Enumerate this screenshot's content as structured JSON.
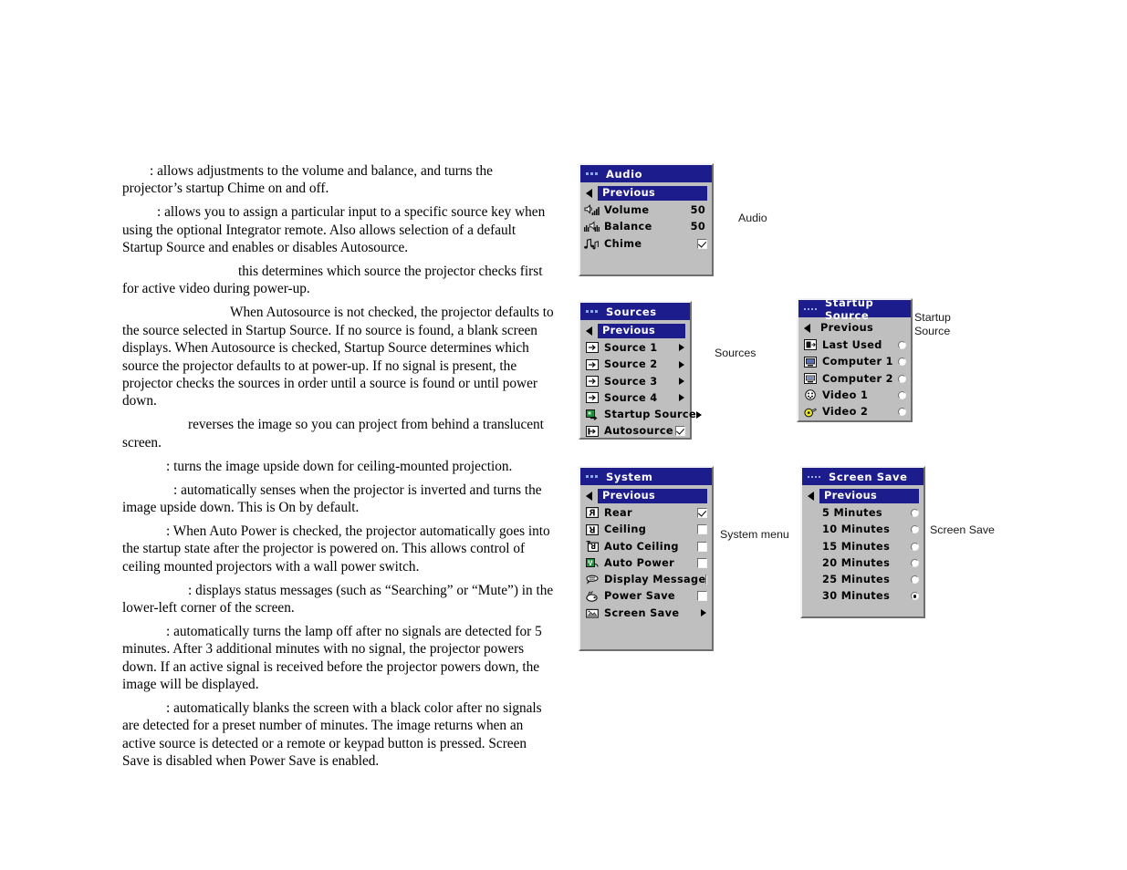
{
  "document": {
    "paragraphs": [
      ": allows adjustments to the volume and balance, and turns the projector’s startup Chime on and off.",
      ": allows you to assign a particular input to a specific source key when using the optional Integrator remote. Also allows selection of a default Startup Source and enables or disables Autosource.",
      "this determines which source the projector checks first for active video during power-up.",
      "When Autosource is not checked, the projector defaults to the source selected in Startup Source. If no source is found, a blank screen displays. When Autosource is checked, Startup Source determines which source the projector defaults to at power-up. If no signal is present, the projector checks the sources in order until a source is found or until power down.",
      "reverses the image so you can project from behind a translucent screen.",
      ": turns the image upside down for ceiling-mounted projection.",
      ": automatically senses when the projector is inverted and turns the image upside down. This is On by default.",
      ": When Auto Power is checked, the projector automatically goes into the startup state after the projector is powered on. This allows control of ceiling mounted projectors with a wall power switch.",
      ": displays status messages (such as “Searching” or “Mute”) in the lower-left corner of the screen.",
      ": automatically turns the lamp off after no signals are detected for 5 minutes. After 3 additional minutes with no signal, the projector powers down. If an active signal is received before the projector powers down, the image will be displayed.",
      ": automatically blanks the screen with a black color after no signals are detected for a preset number of minutes. The image returns when an active source is detected or a remote or keypad button is pressed. Screen Save is disabled when Power Save is enabled."
    ],
    "paragraph_indents": [
      30,
      38,
      127,
      118,
      72,
      48,
      56,
      48,
      72,
      48,
      48
    ]
  },
  "colors": {
    "title_bar": "#1c1c8c",
    "highlight": "#1c1c8c",
    "panel_body": "#bfbfbf",
    "title_text": "#ffffff",
    "video2_connector": "#e8e81a"
  },
  "menus": {
    "audio": {
      "title": "Audio",
      "title_dots": 3,
      "previous_label": "Previous",
      "previous_selected": true,
      "items": [
        {
          "icon": "volume-icon",
          "label": "Volume",
          "value": "50",
          "control": "value"
        },
        {
          "icon": "balance-icon",
          "label": "Balance",
          "value": "50",
          "control": "value"
        },
        {
          "icon": "chime-icon",
          "label": "Chime",
          "value": "",
          "control": "checkbox",
          "checked": true
        }
      ],
      "callout": "Audio"
    },
    "sources": {
      "title": "Sources",
      "title_dots": 3,
      "previous_label": "Previous",
      "previous_selected": true,
      "items": [
        {
          "icon": "source-input-icon",
          "label": "Source 1",
          "control": "submenu"
        },
        {
          "icon": "source-input-icon",
          "label": "Source 2",
          "control": "submenu"
        },
        {
          "icon": "source-input-icon",
          "label": "Source 3",
          "control": "submenu"
        },
        {
          "icon": "source-input-icon",
          "label": "Source 4",
          "control": "submenu"
        },
        {
          "icon": "startup-source-icon",
          "label": "Startup Source",
          "control": "submenu"
        },
        {
          "icon": "autosource-icon",
          "label": "Autosource",
          "control": "checkbox",
          "checked": true
        }
      ],
      "callout": "Sources"
    },
    "startup_source": {
      "title": "Startup Source",
      "title_dots": 4,
      "previous_label": "Previous",
      "previous_selected": false,
      "items": [
        {
          "icon": "last-used-icon",
          "label": "Last Used",
          "control": "radio",
          "selected": false
        },
        {
          "icon": "computer-icon",
          "label": "Computer 1",
          "control": "radio",
          "selected": false
        },
        {
          "icon": "computer-icon",
          "label": "Computer 2",
          "control": "radio",
          "selected": false
        },
        {
          "icon": "s-video-icon",
          "label": "Video 1",
          "control": "radio",
          "selected": false
        },
        {
          "icon": "composite-video-icon",
          "label": "Video 2",
          "control": "radio",
          "selected": false
        }
      ],
      "callout": "Startup\nSource"
    },
    "system": {
      "title": "System",
      "title_dots": 3,
      "previous_label": "Previous",
      "previous_selected": true,
      "items": [
        {
          "icon": "rear-projection-icon",
          "label": "Rear",
          "control": "checkbox",
          "checked": true
        },
        {
          "icon": "ceiling-projection-icon",
          "label": "Ceiling",
          "control": "checkbox",
          "checked": false
        },
        {
          "icon": "auto-ceiling-icon",
          "label": "Auto Ceiling",
          "control": "checkbox",
          "checked": false
        },
        {
          "icon": "auto-power-icon",
          "label": "Auto Power",
          "control": "checkbox",
          "checked": false
        },
        {
          "icon": "display-message-icon",
          "label": "Display Message",
          "control": "checkbox",
          "checked": false
        },
        {
          "icon": "power-save-icon",
          "label": "Power Save",
          "control": "checkbox",
          "checked": false
        },
        {
          "icon": "screen-save-icon",
          "label": "Screen Save",
          "control": "submenu"
        }
      ],
      "callout": "System menu"
    },
    "screen_save": {
      "title": "Screen Save",
      "title_dots": 4,
      "previous_label": "Previous",
      "previous_selected": true,
      "items": [
        {
          "label": "5 Minutes",
          "control": "radio",
          "selected": false
        },
        {
          "label": "10 Minutes",
          "control": "radio",
          "selected": false
        },
        {
          "label": "15 Minutes",
          "control": "radio",
          "selected": false
        },
        {
          "label": "20 Minutes",
          "control": "radio",
          "selected": false
        },
        {
          "label": "25 Minutes",
          "control": "radio",
          "selected": false
        },
        {
          "label": "30 Minutes",
          "control": "radio",
          "selected": true
        }
      ],
      "callout": "Screen Save"
    }
  }
}
